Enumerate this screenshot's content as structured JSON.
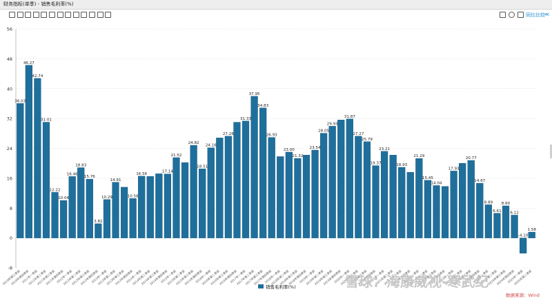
{
  "window": {
    "title": "财务指标(单季) - 销售毛利率(%)"
  },
  "toolbar": {
    "icons": [
      "line-chart-icon",
      "bar-chart-icon",
      "area-chart-icon",
      "stack-icon",
      "column-icon",
      "table-icon",
      "sort-icon",
      "list-icon",
      "grid-icon",
      "trend-icon",
      "fill-icon",
      "image-icon",
      "pin-icon"
    ],
    "right_icons": [
      "download-icon",
      "refresh-icon",
      "chart-icon"
    ],
    "compare_label": "同比比较",
    "collapse_label": "≪"
  },
  "watermark": {
    "text": "雪球：海康威视-寒武纪",
    "source": "数据来源：Wind"
  },
  "colors": {
    "bar": "#1f6f9c",
    "bar_stroke": "#0e4f73",
    "grid": "#d9d9d9",
    "accent": "#1a8fd6"
  },
  "chart_data": {
    "type": "bar",
    "title": "",
    "xlabel": "",
    "ylabel": "",
    "ylim": [
      -8,
      56
    ],
    "yticks": [
      -8,
      0,
      8,
      16,
      24,
      32,
      40,
      48,
      56
    ],
    "grid": true,
    "legend_position": "bottom-center",
    "categories": [
      "2010年第三季度",
      "2010年第四季度",
      "2011年一季度",
      "2011年第二季度",
      "2011年第三季度",
      "2011年第四季度",
      "2012年一季度",
      "2012年第二季度",
      "2012年第三季度",
      "2012年第四季度",
      "2013年一季度",
      "2013年第二季度",
      "2013年第三季度",
      "2013年第四季度",
      "2014年一季度",
      "2014年第二季度",
      "2014年第三季度",
      "2014年第四季度",
      "2015年一季度",
      "2015年第二季度",
      "2015年第三季度",
      "2015年第四季度",
      "2016年一季度",
      "2016年第二季度",
      "2016年第三季度",
      "2016年第四季度",
      "2017年一季度",
      "2017年第二季度",
      "2017年第三季度",
      "2017年第四季度",
      "2018年一季度",
      "2018年第二季度",
      "2018年第三季度",
      "2018年第四季度",
      "2019年一季度",
      "2019年第二季度",
      "2019年第三季度",
      "2019年第四季度",
      "2020年一季度",
      "2020年第二季度",
      "2020年第三季度",
      "2020年第四季度",
      "2021年一季度",
      "2021年第二季度",
      "2021年第三季度",
      "2021年第四季度",
      "2022年一季度",
      "2022年第二季度",
      "2022年第三季度",
      "2022年第四季度",
      "2023年一季度",
      "2023年第二季度",
      "2023年第三季度",
      "2023年第四季度",
      "2024年一季度",
      "2024年第二季度",
      "2024年第三季度",
      "2024年第四季度",
      "2025年一季度",
      "2025年第二季度",
      "2025年第三季度",
      "2025年第四季度"
    ],
    "series": [
      {
        "name": "销售毛利率(%)",
        "values": [
          36.03,
          46.27,
          42.74,
          31.01,
          12.22,
          10.04,
          16.46,
          18.83,
          15.76,
          3.82,
          10.29,
          14.91,
          13.6,
          10.56,
          16.56,
          16.5,
          17.2,
          17.14,
          21.52,
          20.2,
          24.82,
          18.51,
          24.16,
          26.8,
          27.26,
          31.0,
          31.33,
          37.95,
          34.83,
          26.93,
          21.8,
          23.0,
          21.32,
          22.2,
          23.54,
          28.05,
          29.93,
          31.6,
          31.87,
          27.27,
          25.79,
          19.37,
          23.21,
          22.2,
          18.93,
          17.6,
          21.29,
          15.45,
          14.04,
          13.8,
          17.93,
          20.0,
          20.77,
          14.67,
          8.89,
          6.61,
          8.6,
          6.12,
          -4.1,
          1.58
        ]
      }
    ],
    "data_labels": [
      "36.03",
      "46.27",
      "42.74",
      "31.01",
      "12.22",
      "10.04",
      "16.46",
      "18.83",
      "15.76",
      "3.82",
      "10.29",
      "14.91",
      "",
      "10.56",
      "16.56",
      "",
      "",
      "17.14",
      "21.52",
      "",
      "24.82",
      "18.51",
      "24.16",
      "",
      "27.26",
      "",
      "31.33",
      "37.95",
      "34.83",
      "26.93",
      "",
      "23.00",
      "21.32",
      "",
      "23.54",
      "28.05",
      "29.93",
      "",
      "31.87",
      "27.27",
      "25.79",
      "19.37",
      "23.21",
      "",
      "18.93",
      "",
      "21.29",
      "15.45",
      "14.04",
      "",
      "17.93",
      "",
      "20.77",
      "14.67",
      "8.89",
      "6.61",
      "8.60",
      "6.12",
      "-4.10",
      "1.58"
    ]
  }
}
